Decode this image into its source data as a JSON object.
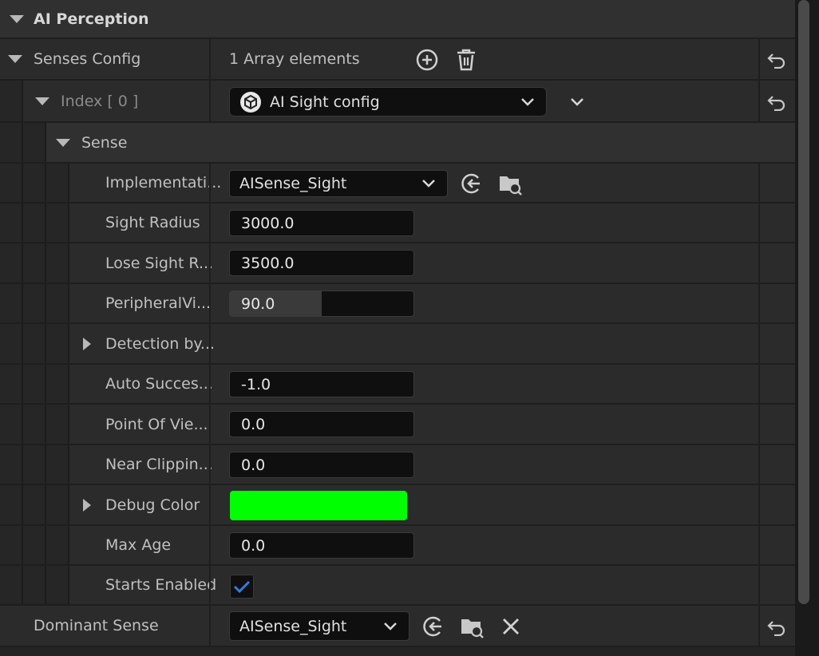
{
  "header": {
    "title": "AI Perception"
  },
  "senses_config": {
    "label": "Senses Config",
    "array_text": "1 Array elements"
  },
  "index_row": {
    "label": "Index [ 0 ]",
    "value": "AI Sight config"
  },
  "sense_row": {
    "label": "Sense"
  },
  "properties": {
    "implementation": {
      "label": "Implementati...",
      "value": "AISense_Sight"
    },
    "sight_radius": {
      "label": "Sight Radius",
      "value": "3000.0"
    },
    "lose_sight": {
      "label": "Lose Sight R...",
      "value": "3500.0"
    },
    "peripheral": {
      "label": "PeripheralVi...",
      "value": "90.0",
      "fill": 0.5
    },
    "detection": {
      "label": "Detection by..."
    },
    "auto_success": {
      "label": "Auto Succes...",
      "value": "-1.0"
    },
    "point_of_view": {
      "label": "Point Of Vie...",
      "value": "0.0"
    },
    "near_clipping": {
      "label": "Near Clippin...",
      "value": "0.0"
    },
    "debug_color": {
      "label": "Debug Color",
      "color": "#00ff00"
    },
    "max_age": {
      "label": "Max Age",
      "value": "0.0"
    },
    "starts_enabled": {
      "label": "Starts Enabled",
      "checked": true
    }
  },
  "dominant_sense": {
    "label": "Dominant Sense",
    "value": "AISense_Sight"
  },
  "icons": {
    "add": "plus-circle-icon",
    "delete": "trash-icon",
    "reset": "reset-to-default-icon",
    "use_selected": "arrow-left-circle-icon",
    "browse": "folder-search-icon",
    "clear": "close-icon",
    "sight_config": "cube-icon"
  },
  "colors": {
    "accent_check": "#2f7de1",
    "debug_green": "#00ff00"
  }
}
